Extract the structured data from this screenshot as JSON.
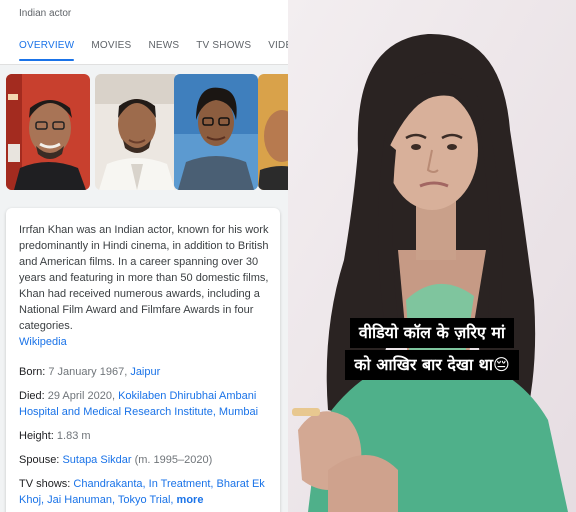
{
  "search": {
    "subtitle": "Indian actor",
    "tabs": [
      {
        "label": "OVERVIEW",
        "active": true
      },
      {
        "label": "MOVIES",
        "active": false
      },
      {
        "label": "NEWS",
        "active": false
      },
      {
        "label": "TV SHOWS",
        "active": false
      },
      {
        "label": "VIDEO",
        "active": false
      }
    ],
    "images": [
      "actor-photo-1",
      "actor-photo-2",
      "actor-photo-3",
      "actor-photo-4"
    ],
    "description": "Irrfan Khan was an Indian actor, known for his work predominantly in Hindi cinema, in addition to British and American films. In a career spanning over 30 years and featuring in more than 50 domestic films, Khan had received numerous awards, including a National Film Award and Filmfare Awards in four categories.",
    "source_link": "Wikipedia",
    "facts": {
      "born": {
        "label": "Born:",
        "value": "7 January 1967,",
        "link": "Jaipur"
      },
      "died": {
        "label": "Died:",
        "value": "29 April 2020,",
        "link": "Kokilaben Dhirubhai Ambani Hospital and Medical Research Institute, Mumbai"
      },
      "height": {
        "label": "Height:",
        "value": "1.83 m"
      },
      "spouse": {
        "label": "Spouse:",
        "link": "Sutapa Sikdar",
        "value": "(m. 1995–2020)"
      },
      "tv_shows": {
        "label": "TV shows:",
        "links": "Chandrakanta, In Treatment, Bharat Ek Khoj, Jai Hanuman, Tokyo Trial,",
        "more": "more"
      }
    }
  },
  "video": {
    "caption_line1": "वीडियो कॉल के ज़रिए मां",
    "caption_line2": "को आखिर बार देखा था😔"
  },
  "colors": {
    "link": "#1a73e8",
    "caption_bg": "#000000",
    "panel_bg": "#f1f3f4"
  }
}
